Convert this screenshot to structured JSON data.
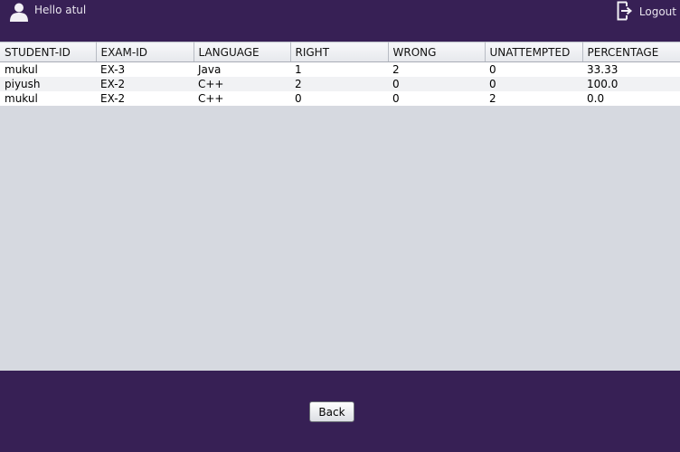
{
  "header": {
    "greeting": "Hello atul",
    "logout_label": "Logout"
  },
  "table": {
    "columns": [
      "STUDENT-ID",
      "EXAM-ID",
      "LANGUAGE",
      "RIGHT",
      "WRONG",
      "UNATTEMPTED",
      "PERCENTAGE"
    ],
    "rows": [
      [
        "mukul",
        "EX-3",
        "Java",
        "1",
        "2",
        "0",
        "33.33"
      ],
      [
        "piyush",
        "EX-2",
        "C++",
        "2",
        "0",
        "0",
        "100.0"
      ],
      [
        "mukul",
        "EX-2",
        "C++",
        "0",
        "0",
        "2",
        "0.0"
      ]
    ]
  },
  "footer": {
    "back_label": "Back"
  },
  "colors": {
    "background": "#372055",
    "panel": "#d6d9e0"
  },
  "icons": {
    "user": "user-icon",
    "logout": "logout-icon"
  }
}
